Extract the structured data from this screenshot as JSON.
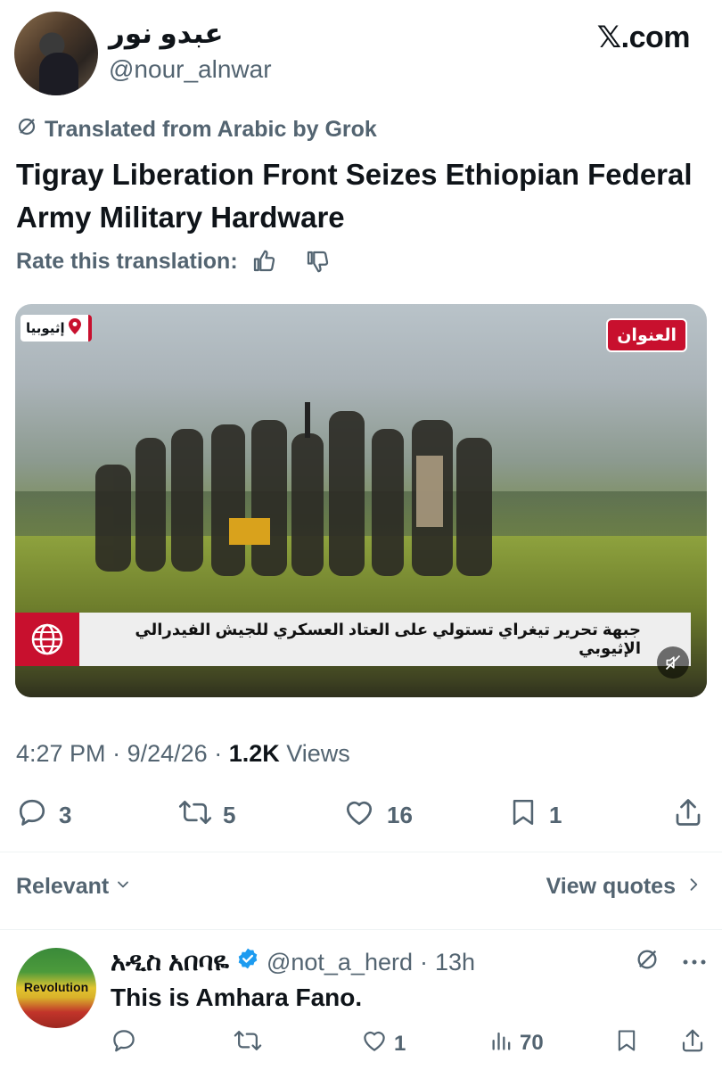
{
  "post": {
    "display_name": "عبدو نور",
    "handle": "@nour_alnwar",
    "site": "𝕏.com",
    "translated_label": "Translated from Arabic by Grok",
    "title": "Tigray Liberation Front Seizes Ethiopian Federal Army Military Hardware",
    "rate_label": "Rate this translation:",
    "media": {
      "location_tag": "إثيوبيا",
      "channel_logo": "العنوان",
      "news_caption": "جبهة تحرير تيغراي تستولي على العتاد العسكري للجيش الفيدرالي الإثيوبي"
    },
    "time": "4:27 PM",
    "date": "9/24/26",
    "views_count": "1.2K",
    "views_label": "Views",
    "actions": {
      "replies": "3",
      "reposts": "5",
      "likes": "16",
      "bookmarks": "1"
    }
  },
  "sort": {
    "relevant_label": "Relevant",
    "view_quotes_label": "View quotes"
  },
  "reply": {
    "avatar_text": "Revolution",
    "display_name": "አዲስ አበባዬ",
    "handle": "@not_a_herd",
    "time": "13h",
    "text": "This is Amhara Fano.",
    "actions": {
      "replies": "",
      "reposts": "",
      "likes": "1",
      "views": "70"
    }
  },
  "colors": {
    "text": "#0f1419",
    "secondary": "#536471",
    "verified": "#1d9bf0",
    "news_red": "#c8102e"
  }
}
